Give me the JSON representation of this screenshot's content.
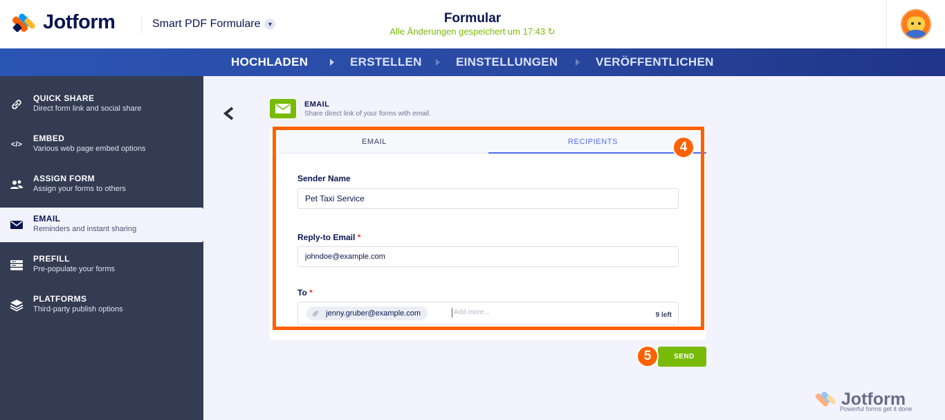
{
  "header": {
    "logo_text": "Jotform",
    "product": "Smart PDF Formulare",
    "form_title": "Formular",
    "saved_status": "Alle Änderungen gespeichert um 17:43 ↻"
  },
  "steps": [
    {
      "label": "HOCHLADEN"
    },
    {
      "label": "ERSTELLEN"
    },
    {
      "label": "EINSTELLUNGEN"
    },
    {
      "label": "VERÖFFENTLICHEN"
    }
  ],
  "sidebar": {
    "items": [
      {
        "title": "QUICK SHARE",
        "subtitle": "Direct form link and social share",
        "icon": "link-icon"
      },
      {
        "title": "EMBED",
        "subtitle": "Various web page embed options",
        "icon": "code-icon"
      },
      {
        "title": "ASSIGN FORM",
        "subtitle": "Assign your forms to others",
        "icon": "users-icon"
      },
      {
        "title": "EMAIL",
        "subtitle": "Reminders and instant sharing",
        "icon": "envelope-icon"
      },
      {
        "title": "PREFILL",
        "subtitle": "Pre-populate your forms",
        "icon": "prefill-icon"
      },
      {
        "title": "PLATFORMS",
        "subtitle": "Third-party publish options",
        "icon": "layers-icon"
      }
    ],
    "active": "EMAIL"
  },
  "section": {
    "title": "EMAIL",
    "subtitle": "Share direct link of your forms with email."
  },
  "tabs": [
    {
      "label": "EMAIL"
    },
    {
      "label": "RECIPIENTS"
    }
  ],
  "active_tab": "RECIPIENTS",
  "form": {
    "sender_label": "Sender Name",
    "sender_value": "Pet Taxi Service",
    "reply_label": "Reply-to Email",
    "reply_value": "johndoe@example.com",
    "to_label": "To",
    "required_mark": "*",
    "to_chip": "jenny.gruber@example.com",
    "to_placeholder": "Add more...",
    "to_remaining": "9 left"
  },
  "annotations": {
    "badge_4": "4",
    "badge_5": "5"
  },
  "send_label": "SEND",
  "watermark": {
    "text": "Jotform",
    "tagline": "Powerful forms get it done"
  },
  "colors": {
    "brand_orange": "#ff6100",
    "brand_navy": "#0a1551",
    "accent_green": "#78bb07",
    "accent_blue": "#4f6cf0",
    "sidebar_bg": "#343c53"
  }
}
